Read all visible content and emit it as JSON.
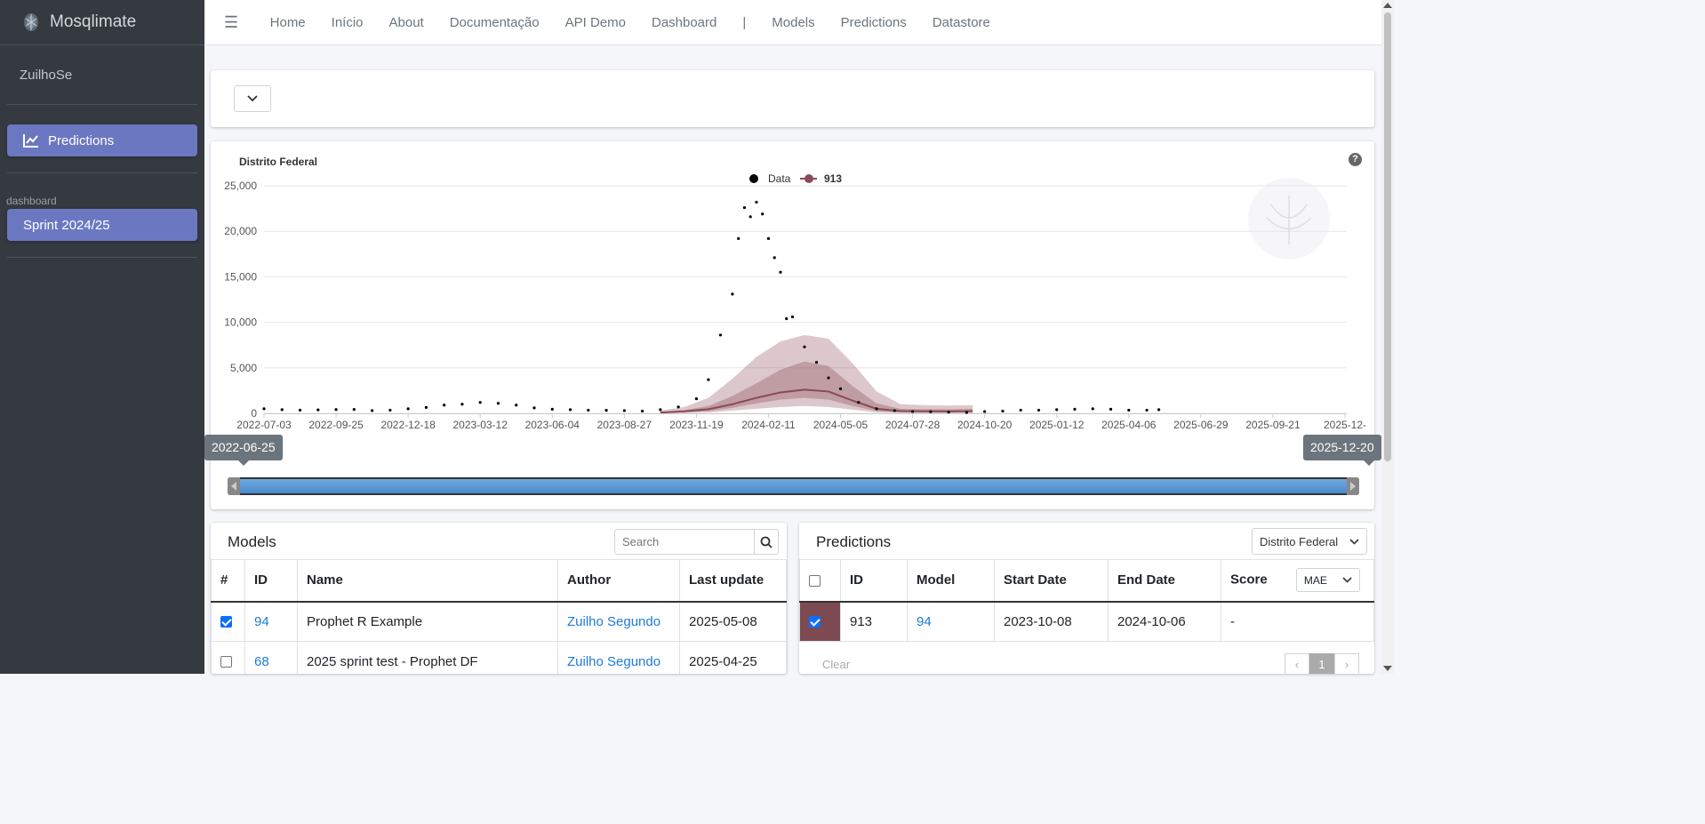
{
  "app": {
    "brand": "Mosqlimate"
  },
  "sidebar": {
    "user": "ZuilhoSe",
    "predictions_label": "Predictions",
    "section_header": "dashboard",
    "sprint_label": "Sprint 2024/25"
  },
  "topnav": {
    "items": [
      "Home",
      "Início",
      "About",
      "Documentação",
      "API Demo",
      "Dashboard",
      "|",
      "Models",
      "Predictions",
      "Datastore"
    ]
  },
  "chart": {
    "title": "Distrito Federal",
    "help": "?",
    "legend": {
      "data": "Data",
      "prediction": "913"
    },
    "colors": {
      "prediction": "#8b4a55",
      "data": "#000000"
    },
    "slider": {
      "start": "2022-06-25",
      "end": "2025-12-20"
    }
  },
  "chart_data": {
    "type": "line",
    "title": "Distrito Federal",
    "y_ticks": [
      "25,000",
      "20,000",
      "15,000",
      "10,000",
      "5,000",
      "0"
    ],
    "x_ticks": [
      "2022-07-03",
      "2022-09-25",
      "2022-12-18",
      "2023-03-12",
      "2023-06-04",
      "2023-08-27",
      "2023-11-19",
      "2024-02-11",
      "2024-05-05",
      "2024-07-28",
      "2024-10-20",
      "2025-01-12",
      "2025-04-06",
      "2025-06-29",
      "2025-09-21",
      "2025-12-"
    ],
    "x_range": [
      "2022-07-03",
      "2025-12-14"
    ],
    "ylim": [
      0,
      25000
    ],
    "series": [
      {
        "name": "Data",
        "kind": "scatter",
        "points": [
          [
            "2022-07-03",
            500
          ],
          [
            "2022-07-24",
            400
          ],
          [
            "2022-08-14",
            350
          ],
          [
            "2022-09-04",
            380
          ],
          [
            "2022-09-25",
            420
          ],
          [
            "2022-10-16",
            430
          ],
          [
            "2022-11-06",
            300
          ],
          [
            "2022-11-27",
            350
          ],
          [
            "2022-12-18",
            500
          ],
          [
            "2023-01-08",
            650
          ],
          [
            "2023-01-29",
            900
          ],
          [
            "2023-02-19",
            1000
          ],
          [
            "2023-03-12",
            1200
          ],
          [
            "2023-04-02",
            1100
          ],
          [
            "2023-04-23",
            900
          ],
          [
            "2023-05-14",
            600
          ],
          [
            "2023-06-04",
            450
          ],
          [
            "2023-06-25",
            400
          ],
          [
            "2023-07-16",
            350
          ],
          [
            "2023-08-06",
            330
          ],
          [
            "2023-08-27",
            300
          ],
          [
            "2023-09-17",
            250
          ],
          [
            "2023-10-08",
            400
          ],
          [
            "2023-10-29",
            700
          ],
          [
            "2023-11-19",
            1600
          ],
          [
            "2023-12-03",
            3700
          ],
          [
            "2023-12-17",
            8600
          ],
          [
            "2023-12-31",
            13100
          ],
          [
            "2024-01-07",
            19200
          ],
          [
            "2024-01-14",
            22600
          ],
          [
            "2024-01-21",
            21600
          ],
          [
            "2024-01-28",
            23200
          ],
          [
            "2024-02-04",
            21900
          ],
          [
            "2024-02-11",
            19200
          ],
          [
            "2024-02-18",
            17100
          ],
          [
            "2024-02-25",
            15500
          ],
          [
            "2024-03-03",
            10400
          ],
          [
            "2024-03-10",
            10600
          ],
          [
            "2024-03-24",
            7300
          ],
          [
            "2024-04-07",
            5600
          ],
          [
            "2024-04-21",
            3900
          ],
          [
            "2024-05-05",
            2700
          ],
          [
            "2024-05-26",
            1200
          ],
          [
            "2024-06-16",
            500
          ],
          [
            "2024-07-07",
            300
          ],
          [
            "2024-07-28",
            200
          ],
          [
            "2024-08-18",
            180
          ],
          [
            "2024-09-08",
            150
          ],
          [
            "2024-09-29",
            100
          ],
          [
            "2024-10-20",
            200
          ],
          [
            "2024-11-10",
            250
          ],
          [
            "2024-12-01",
            350
          ],
          [
            "2024-12-22",
            350
          ],
          [
            "2025-01-12",
            400
          ],
          [
            "2025-02-02",
            450
          ],
          [
            "2025-02-23",
            500
          ],
          [
            "2025-03-16",
            450
          ],
          [
            "2025-04-06",
            350
          ],
          [
            "2025-04-27",
            350
          ],
          [
            "2025-05-11",
            400
          ]
        ]
      },
      {
        "name": "913",
        "kind": "line-with-intervals",
        "x": [
          "2023-10-08",
          "2023-11-05",
          "2023-12-03",
          "2023-12-31",
          "2024-01-28",
          "2024-02-25",
          "2024-03-24",
          "2024-04-21",
          "2024-05-19",
          "2024-06-16",
          "2024-07-14",
          "2024-08-11",
          "2024-09-08",
          "2024-10-06"
        ],
        "median": [
          80,
          220,
          450,
          1000,
          1700,
          2300,
          2600,
          2400,
          1400,
          500,
          250,
          220,
          210,
          230
        ],
        "lower_50": [
          40,
          120,
          250,
          600,
          1100,
          1500,
          1700,
          1500,
          800,
          250,
          120,
          100,
          100,
          120
        ],
        "upper_50": [
          150,
          350,
          800,
          1900,
          3300,
          4800,
          5700,
          5200,
          3000,
          1100,
          500,
          450,
          450,
          500
        ],
        "lower_90": [
          10,
          50,
          100,
          300,
          500,
          700,
          800,
          700,
          400,
          100,
          40,
          30,
          30,
          40
        ],
        "upper_90": [
          300,
          700,
          1700,
          3800,
          6200,
          7900,
          8600,
          8200,
          5500,
          2400,
          1000,
          900,
          850,
          900
        ]
      }
    ]
  },
  "models": {
    "title": "Models",
    "search_placeholder": "Search",
    "columns": [
      "#",
      "ID",
      "Name",
      "Author",
      "Last update"
    ],
    "rows": [
      {
        "checked": true,
        "id": "94",
        "name": "Prophet R Example",
        "author": "Zuilho Segundo",
        "updated": "2025-05-08"
      },
      {
        "checked": false,
        "id": "68",
        "name": "2025 sprint test - Prophet DF",
        "author": "Zuilho Segundo",
        "updated": "2025-04-25"
      }
    ]
  },
  "predictions": {
    "title": "Predictions",
    "region": "Distrito Federal",
    "columns": [
      "ID",
      "Model",
      "Start Date",
      "End Date",
      "Score"
    ],
    "score_metric": "MAE",
    "rows": [
      {
        "checked": true,
        "color": "#7d4a52",
        "id": "913",
        "model": "94",
        "start": "2023-10-08",
        "end": "2024-10-06",
        "score": "-"
      }
    ],
    "clear_label": "Clear",
    "pager": {
      "prev": "‹",
      "page": "1",
      "next": "›"
    }
  }
}
